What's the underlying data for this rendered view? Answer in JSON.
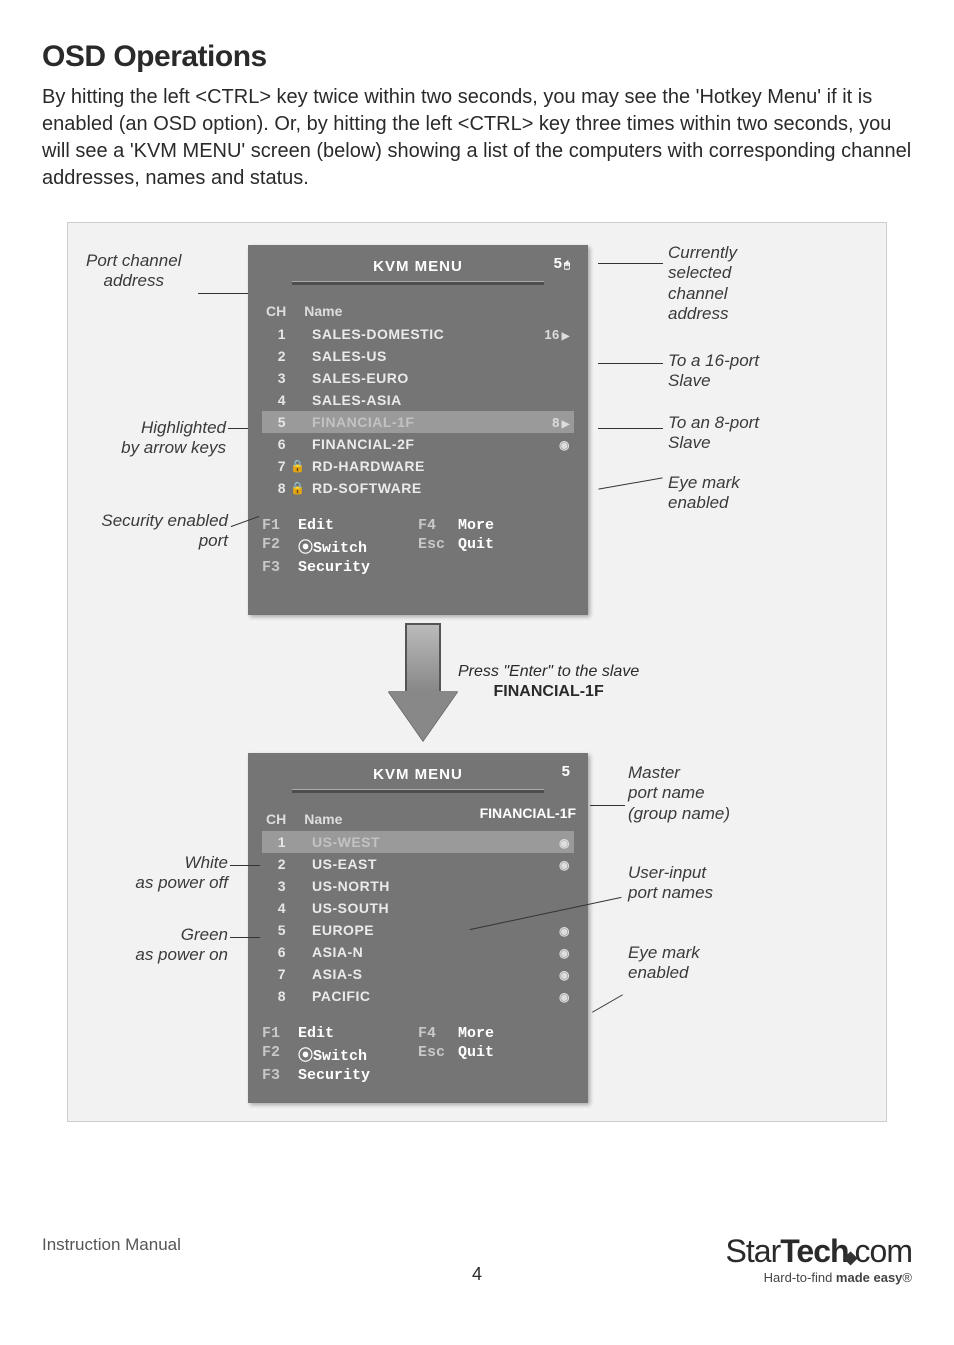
{
  "heading": "OSD Operations",
  "intro": "By hitting the left <CTRL> key twice within two seconds, you may see the 'Hotkey Menu' if it is enabled (an OSD option). Or, by hitting the left <CTRL> key three times within two seconds, you will see a 'KVM MENU' screen (below) showing a list of the computers with corresponding channel addresses, names and status.",
  "osd_top": {
    "title": "KVM MENU",
    "corner": "5",
    "hdr_ch": "CH",
    "hdr_name": "Name",
    "rows": [
      {
        "ch": "1",
        "name": "SALES-DOMESTIC",
        "right": "16",
        "tri": true
      },
      {
        "ch": "2",
        "name": "SALES-US"
      },
      {
        "ch": "3",
        "name": "SALES-EURO"
      },
      {
        "ch": "4",
        "name": "SALES-ASIA"
      },
      {
        "ch": "5",
        "name": "FINANCIAL-1F",
        "right": "8",
        "tri": true,
        "hl": true
      },
      {
        "ch": "6",
        "name": "FINANCIAL-2F",
        "eye": true
      },
      {
        "ch": "7",
        "name": "RD-HARDWARE",
        "lock": true
      },
      {
        "ch": "8",
        "name": "RD-SOFTWARE",
        "lock": true
      }
    ],
    "fn": {
      "f1k": "F1",
      "f1t": "Edit",
      "f2k": "F2",
      "f2t": "⦿Switch",
      "f3k": "F3",
      "f3t": "Security",
      "f4k": "F4",
      "f4t": "More",
      "esck": "Esc",
      "esct": "Quit"
    }
  },
  "press_enter": "Press \"Enter\" to the slave",
  "press_enter_sub": "FINANCIAL-1F",
  "osd_bot": {
    "title": "KVM MENU",
    "corner": "5",
    "sub": "FINANCIAL-1F",
    "hdr_ch": "CH",
    "hdr_name": "Name",
    "rows": [
      {
        "ch": "1",
        "name": "US-WEST",
        "eye": true,
        "hl": true
      },
      {
        "ch": "2",
        "name": "US-EAST",
        "eye": true
      },
      {
        "ch": "3",
        "name": "US-NORTH"
      },
      {
        "ch": "4",
        "name": "US-SOUTH"
      },
      {
        "ch": "5",
        "name": "EUROPE",
        "eye": true
      },
      {
        "ch": "6",
        "name": "ASIA-N",
        "eye": true
      },
      {
        "ch": "7",
        "name": "ASIA-S",
        "eye": true
      },
      {
        "ch": "8",
        "name": "PACIFIC",
        "eye": true
      }
    ],
    "fn": {
      "f1k": "F1",
      "f1t": "Edit",
      "f2k": "F2",
      "f2t": "⦿Switch",
      "f3k": "F3",
      "f3t": "Security",
      "f4k": "F4",
      "f4t": "More",
      "esck": "Esc",
      "esct": "Quit"
    }
  },
  "annot": {
    "port_channel": "Port channel\naddress",
    "highlighted": "Highlighted\nby arrow keys",
    "security": "Security enabled\nport",
    "current": "Currently\nselected\nchannel\naddress",
    "to16": "To a 16-port\nSlave",
    "to8": "To an 8-port\nSlave",
    "eye1": "Eye mark\nenabled",
    "master": "Master\nport name\n(group name)",
    "white": "White\nas power off",
    "green": "Green\nas power on",
    "userinput": "User-input\nport names",
    "eye2": "Eye mark\nenabled"
  },
  "footer_left": "Instruction Manual",
  "page_num": "4",
  "brand_a": "Star",
  "brand_b": "Tech",
  "brand_c": "com",
  "tagline_a": "Hard-to-find ",
  "tagline_b": "made easy",
  "reg": "®"
}
